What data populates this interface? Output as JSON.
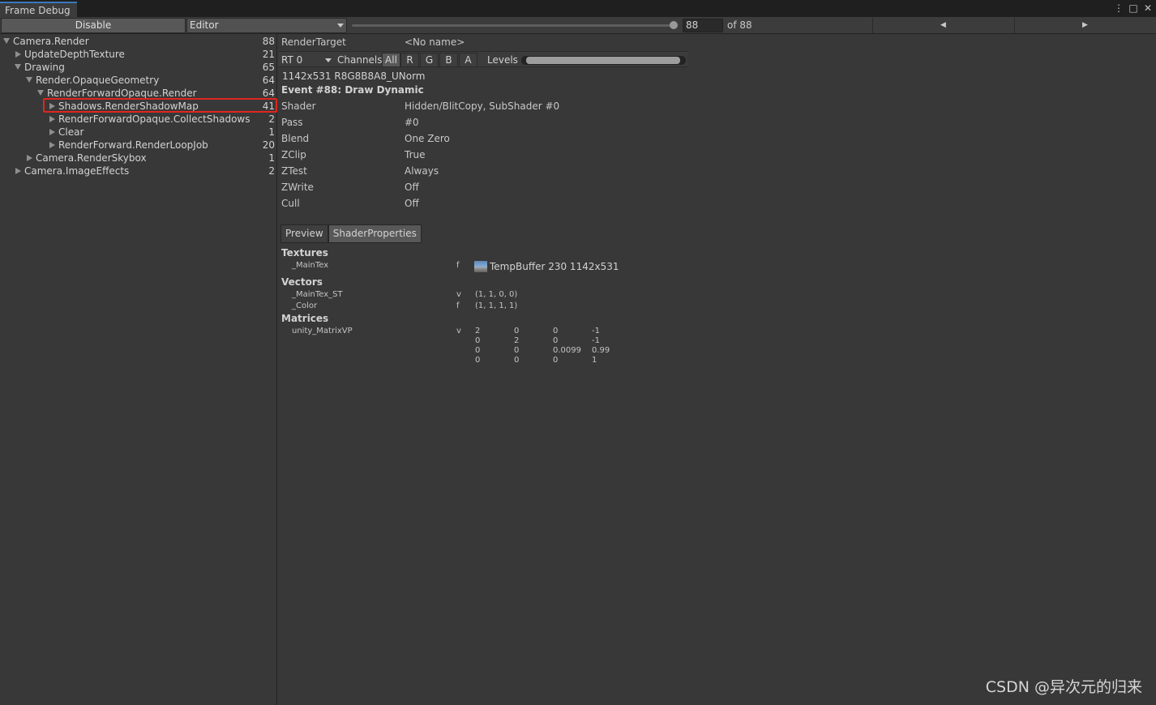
{
  "window": {
    "tab_title": "Frame Debug",
    "menu_icon": "more-icon",
    "maximize_icon": "maximize-icon",
    "close_icon": "close-icon"
  },
  "toolbar": {
    "disable_label": "Disable",
    "target_label": "Editor",
    "frame_value": "88",
    "frame_of": "of 88",
    "prev_icon": "◀",
    "next_icon": "▶"
  },
  "tree": {
    "items": [
      {
        "label": "Camera.Render",
        "count": "88"
      },
      {
        "label": "UpdateDepthTexture",
        "count": "21"
      },
      {
        "label": "Drawing",
        "count": "65"
      },
      {
        "label": "Render.OpaqueGeometry",
        "count": "64"
      },
      {
        "label": "RenderForwardOpaque.Render",
        "count": "64"
      },
      {
        "label": "Shadows.RenderShadowMap",
        "count": "41"
      },
      {
        "label": "RenderForwardOpaque.CollectShadows",
        "count": "2"
      },
      {
        "label": "Clear",
        "count": "1"
      },
      {
        "label": "RenderForward.RenderLoopJob",
        "count": "20"
      },
      {
        "label": "Camera.RenderSkybox",
        "count": "1"
      },
      {
        "label": "Camera.ImageEffects",
        "count": "2"
      }
    ]
  },
  "details": {
    "render_target_label": "RenderTarget",
    "render_target_value": "<No name>",
    "rt_select": "RT 0",
    "channels_label": "Channels",
    "channels": [
      "All",
      "R",
      "G",
      "B",
      "A"
    ],
    "levels_label": "Levels",
    "format": "1142x531 R8G8B8A8_UNorm",
    "event_title": "Event #88: Draw Dynamic",
    "props": [
      {
        "label": "Shader",
        "value": "Hidden/BlitCopy, SubShader #0"
      },
      {
        "label": "Pass",
        "value": "#0"
      },
      {
        "label": "Blend",
        "value": "One Zero"
      },
      {
        "label": "ZClip",
        "value": "True"
      },
      {
        "label": "ZTest",
        "value": "Always"
      },
      {
        "label": "ZWrite",
        "value": "Off"
      },
      {
        "label": "Cull",
        "value": "Off"
      }
    ],
    "tabs": [
      "Preview",
      "ShaderProperties"
    ],
    "textures_title": "Textures",
    "texture": {
      "name": "_MainTex",
      "stage": "f",
      "value": "TempBuffer 230 1142x531"
    },
    "vectors_title": "Vectors",
    "vectors": [
      {
        "name": "_MainTex_ST",
        "stage": "v",
        "value": "(1, 1, 0, 0)"
      },
      {
        "name": "_Color",
        "stage": "f",
        "value": "(1, 1, 1, 1)"
      }
    ],
    "matrices_title": "Matrices",
    "matrix": {
      "name": "unity_MatrixVP",
      "stage": "v",
      "rows": [
        [
          "2",
          "0",
          "0",
          "-1"
        ],
        [
          "0",
          "2",
          "0",
          "-1"
        ],
        [
          "0",
          "0",
          "0.0099",
          "0.99"
        ],
        [
          "0",
          "0",
          "0",
          "1"
        ]
      ]
    }
  },
  "watermark": "CSDN @异次元的归来",
  "colors": {
    "highlight": "#e0261f",
    "tab_accent": "#3a79bb"
  }
}
